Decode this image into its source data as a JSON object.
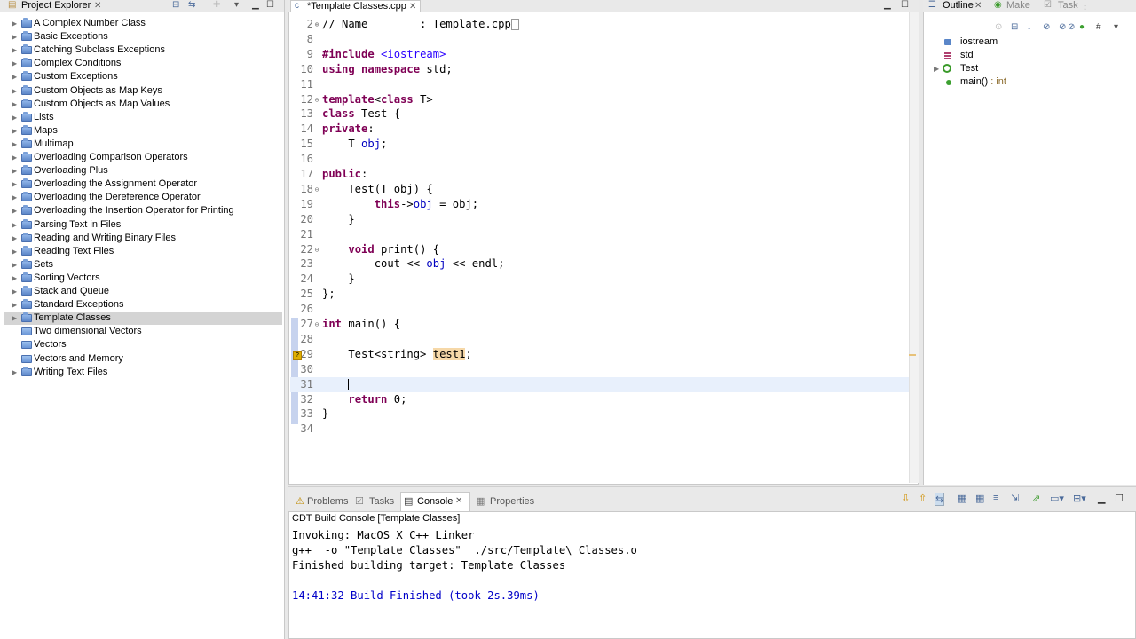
{
  "project_explorer": {
    "title": "Project Explorer",
    "close": "✕",
    "items": [
      {
        "label": "A Complex Number Class",
        "type": "project",
        "expand": "▶"
      },
      {
        "label": "Basic Exceptions",
        "type": "project",
        "expand": "▶"
      },
      {
        "label": "Catching Subclass Exceptions",
        "type": "project",
        "expand": "▶"
      },
      {
        "label": "Complex Conditions",
        "type": "project",
        "expand": "▶"
      },
      {
        "label": "Custom Exceptions",
        "type": "project",
        "expand": "▶"
      },
      {
        "label": "Custom Objects as Map Keys",
        "type": "project",
        "expand": "▶"
      },
      {
        "label": "Custom Objects as Map Values",
        "type": "project",
        "expand": "▶"
      },
      {
        "label": "Lists",
        "type": "project",
        "expand": "▶"
      },
      {
        "label": "Maps",
        "type": "project",
        "expand": "▶"
      },
      {
        "label": "Multimap",
        "type": "project",
        "expand": "▶"
      },
      {
        "label": "Overloading Comparison Operators",
        "type": "project",
        "expand": "▶"
      },
      {
        "label": "Overloading Plus",
        "type": "project",
        "expand": "▶"
      },
      {
        "label": "Overloading the Assignment Operator",
        "type": "project",
        "expand": "▶"
      },
      {
        "label": "Overloading the Dereference Operator",
        "type": "project",
        "expand": "▶"
      },
      {
        "label": "Overloading the Insertion Operator for Printing",
        "type": "project",
        "expand": "▶"
      },
      {
        "label": "Parsing Text in Files",
        "type": "project",
        "expand": "▶"
      },
      {
        "label": "Reading and Writing Binary Files",
        "type": "project",
        "expand": "▶"
      },
      {
        "label": "Reading Text Files",
        "type": "project",
        "expand": "▶"
      },
      {
        "label": "Sets",
        "type": "project",
        "expand": "▶"
      },
      {
        "label": "Sorting Vectors",
        "type": "project",
        "expand": "▶"
      },
      {
        "label": "Stack and Queue",
        "type": "project",
        "expand": "▶"
      },
      {
        "label": "Standard Exceptions",
        "type": "project",
        "expand": "▶"
      },
      {
        "label": "Template Classes",
        "type": "project",
        "expand": "▶",
        "selected": true
      },
      {
        "label": "Two dimensional Vectors",
        "type": "folder",
        "expand": ""
      },
      {
        "label": "Vectors",
        "type": "folder",
        "expand": ""
      },
      {
        "label": "Vectors and Memory",
        "type": "folder",
        "expand": ""
      },
      {
        "label": "Writing Text Files",
        "type": "project",
        "expand": "▶"
      }
    ]
  },
  "editor": {
    "tab_title": "*Template Classes.cpp",
    "close": "✕",
    "lines": [
      {
        "n": "2",
        "fold": "⊕",
        "segs": [
          {
            "t": "// Name        : Template.cpp",
            "c": ""
          }
        ],
        "box": true
      },
      {
        "n": "8",
        "fold": "",
        "segs": []
      },
      {
        "n": "9",
        "fold": "",
        "segs": [
          {
            "t": "#include",
            "c": "kw"
          },
          {
            "t": " ",
            "c": ""
          },
          {
            "t": "<iostream>",
            "c": "inc"
          }
        ]
      },
      {
        "n": "10",
        "fold": "",
        "segs": [
          {
            "t": "using",
            "c": "kw"
          },
          {
            "t": " ",
            "c": ""
          },
          {
            "t": "namespace",
            "c": "kw"
          },
          {
            "t": " std;",
            "c": ""
          }
        ]
      },
      {
        "n": "11",
        "fold": "",
        "segs": []
      },
      {
        "n": "12",
        "fold": "⊖",
        "segs": [
          {
            "t": "template",
            "c": "kw"
          },
          {
            "t": "<",
            "c": ""
          },
          {
            "t": "class",
            "c": "kw"
          },
          {
            "t": " T>",
            "c": ""
          }
        ]
      },
      {
        "n": "13",
        "fold": "",
        "segs": [
          {
            "t": "class",
            "c": "kw"
          },
          {
            "t": " Test {",
            "c": ""
          }
        ]
      },
      {
        "n": "14",
        "fold": "",
        "segs": [
          {
            "t": "private",
            "c": "kw"
          },
          {
            "t": ":",
            "c": ""
          }
        ]
      },
      {
        "n": "15",
        "fold": "",
        "segs": [
          {
            "t": "    T ",
            "c": ""
          },
          {
            "t": "obj",
            "c": "field"
          },
          {
            "t": ";",
            "c": ""
          }
        ]
      },
      {
        "n": "16",
        "fold": "",
        "segs": []
      },
      {
        "n": "17",
        "fold": "",
        "segs": [
          {
            "t": "public",
            "c": "kw"
          },
          {
            "t": ":",
            "c": ""
          }
        ]
      },
      {
        "n": "18",
        "fold": "⊖",
        "segs": [
          {
            "t": "    Test(T obj) {",
            "c": ""
          }
        ]
      },
      {
        "n": "19",
        "fold": "",
        "segs": [
          {
            "t": "        ",
            "c": ""
          },
          {
            "t": "this",
            "c": "kw"
          },
          {
            "t": "->",
            "c": ""
          },
          {
            "t": "obj",
            "c": "field"
          },
          {
            "t": " = obj;",
            "c": ""
          }
        ]
      },
      {
        "n": "20",
        "fold": "",
        "segs": [
          {
            "t": "    }",
            "c": ""
          }
        ]
      },
      {
        "n": "21",
        "fold": "",
        "segs": []
      },
      {
        "n": "22",
        "fold": "⊖",
        "segs": [
          {
            "t": "    ",
            "c": ""
          },
          {
            "t": "void",
            "c": "kw"
          },
          {
            "t": " print() {",
            "c": ""
          }
        ]
      },
      {
        "n": "23",
        "fold": "",
        "segs": [
          {
            "t": "        cout << ",
            "c": ""
          },
          {
            "t": "obj",
            "c": "field"
          },
          {
            "t": " << endl;",
            "c": ""
          }
        ]
      },
      {
        "n": "24",
        "fold": "",
        "segs": [
          {
            "t": "    }",
            "c": ""
          }
        ]
      },
      {
        "n": "25",
        "fold": "",
        "segs": [
          {
            "t": "};",
            "c": ""
          }
        ]
      },
      {
        "n": "26",
        "fold": "",
        "segs": []
      },
      {
        "n": "27",
        "fold": "⊖",
        "segs": [
          {
            "t": "int",
            "c": "kw"
          },
          {
            "t": " main() {",
            "c": ""
          }
        ]
      },
      {
        "n": "28",
        "fold": "",
        "segs": []
      },
      {
        "n": "29",
        "fold": "",
        "segs": [
          {
            "t": "    Test<string> ",
            "c": ""
          },
          {
            "t": "test1",
            "c": "warnbox"
          },
          {
            "t": ";",
            "c": ""
          }
        ]
      },
      {
        "n": "30",
        "fold": "",
        "segs": []
      },
      {
        "n": "31",
        "fold": "",
        "segs": [
          {
            "t": "    ",
            "c": ""
          }
        ],
        "cursor": true
      },
      {
        "n": "32",
        "fold": "",
        "segs": [
          {
            "t": "    ",
            "c": ""
          },
          {
            "t": "return",
            "c": "kw"
          },
          {
            "t": " 0;",
            "c": ""
          }
        ]
      },
      {
        "n": "33",
        "fold": "",
        "segs": [
          {
            "t": "}",
            "c": ""
          }
        ]
      },
      {
        "n": "34",
        "fold": "",
        "segs": []
      }
    ],
    "warning_marker": "?"
  },
  "outline": {
    "tabs": [
      {
        "label": "Outline",
        "icon": "☰"
      },
      {
        "label": "Make",
        "icon": "◉"
      },
      {
        "label": "Task",
        "icon": "☑"
      }
    ],
    "close": "✕",
    "items": [
      {
        "label": "iostream",
        "kind": "include",
        "suffix": ""
      },
      {
        "label": "std",
        "kind": "namespace",
        "suffix": ""
      },
      {
        "label": "Test",
        "kind": "template-class",
        "suffix": "",
        "expand": "▶"
      },
      {
        "label": "main()",
        "kind": "function",
        "suffix": " : int"
      }
    ]
  },
  "bottom_panel": {
    "tabs": [
      {
        "label": "Problems",
        "icon": "⚠"
      },
      {
        "label": "Tasks",
        "icon": "☑"
      },
      {
        "label": "Console",
        "icon": "▤"
      },
      {
        "label": "Properties",
        "icon": "▦"
      }
    ],
    "close": "✕",
    "console_title": "CDT Build Console [Template Classes]",
    "console_lines": [
      {
        "t": "Invoking: MacOS X C++ Linker",
        "c": ""
      },
      {
        "t": "g++  -o \"Template Classes\"  ./src/Template\\ Classes.o",
        "c": ""
      },
      {
        "t": "Finished building target: Template Classes",
        "c": ""
      },
      {
        "t": "",
        "c": ""
      },
      {
        "t": "14:41:32 Build Finished (took 2s.39ms)",
        "c": "blue"
      }
    ]
  },
  "colors": {
    "keyword": "#7f0055",
    "include": "#2a00ff",
    "field": "#0000c0",
    "console_blue": "#0000c8",
    "selection": "#d4d4d4",
    "current_line": "#e8f0fc"
  }
}
